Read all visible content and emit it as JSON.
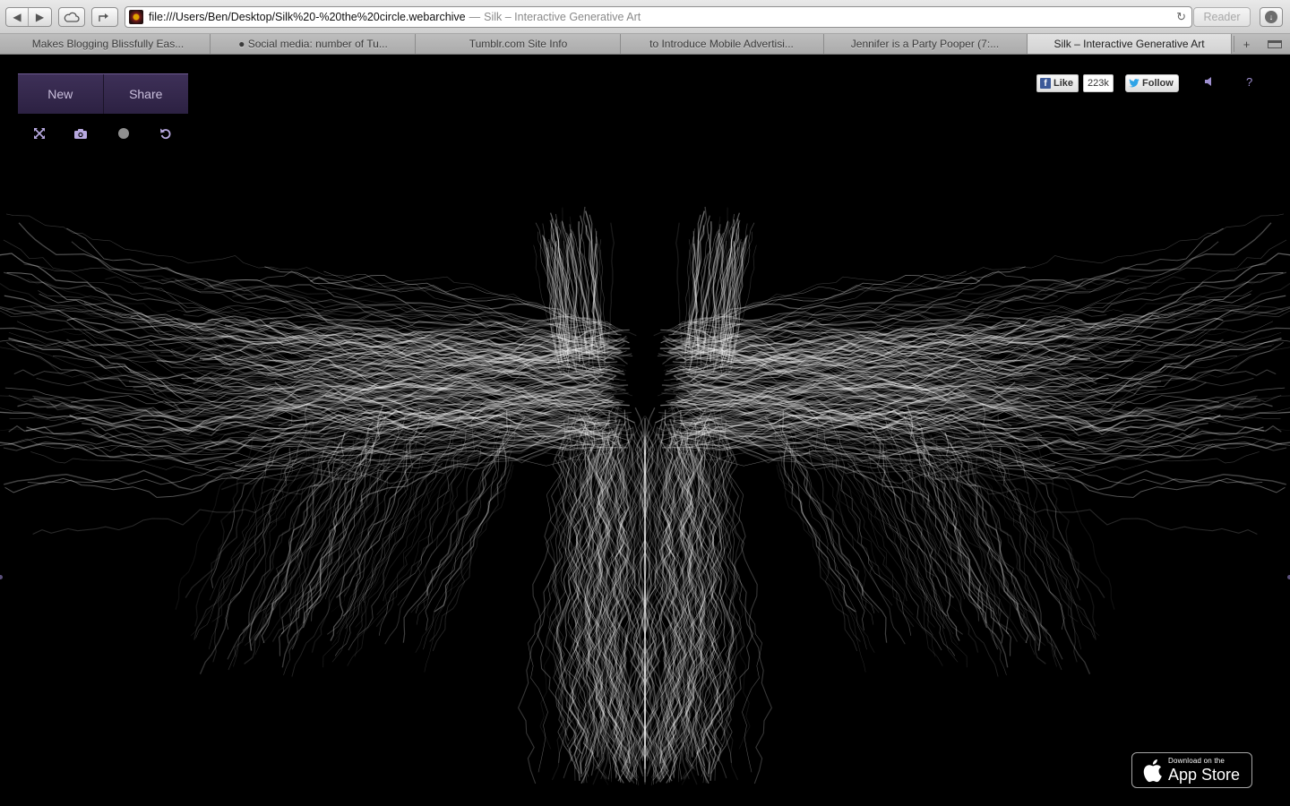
{
  "browser": {
    "address_path": "file:///Users/Ben/Desktop/Silk%20-%20the%20circle.webarchive",
    "address_separator": "—",
    "address_title": "Silk – Interactive Generative Art",
    "reader_label": "Reader",
    "tabs": [
      {
        "label": "Makes Blogging Blissfully Eas..."
      },
      {
        "label": "● Social media: number of Tu..."
      },
      {
        "label": "Tumblr.com Site Info"
      },
      {
        "label": "to Introduce Mobile Advertisi..."
      },
      {
        "label": "Jennifer is a Party Pooper (7:..."
      },
      {
        "label": "Silk – Interactive Generative Art"
      }
    ],
    "active_tab_index": 5
  },
  "silk": {
    "menu": {
      "new_label": "New",
      "share_label": "Share"
    },
    "tools": [
      "fullscreen-icon",
      "camera-icon",
      "brush-dot-icon",
      "undo-icon"
    ],
    "social": {
      "like_label": "Like",
      "like_count": "223k",
      "follow_label": "Follow"
    },
    "help_label": "?",
    "appstore": {
      "small": "Download on the",
      "big": "App Store"
    },
    "colors": {
      "accent": "#3e3058",
      "icon": "#b8a9e0",
      "art": "#ffffff",
      "background": "#000000"
    }
  }
}
